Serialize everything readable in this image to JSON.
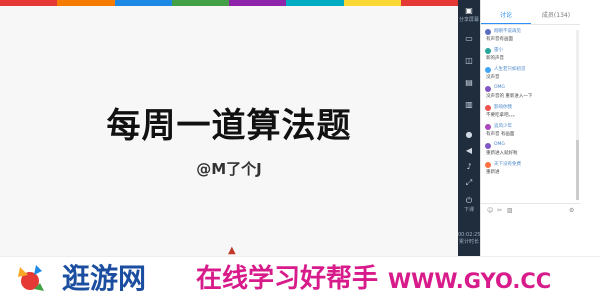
{
  "slide": {
    "title": "每周一道算法题",
    "subtitle": "@M了个J"
  },
  "stripe_colors": [
    "#e53935",
    "#f57c00",
    "#1e88e5",
    "#43a047",
    "#8e24aa",
    "#00acc1",
    "#fdd835",
    "#e53935"
  ],
  "toolbar": {
    "items": [
      {
        "icon": "screen-share-icon",
        "label": "分享屏幕"
      },
      {
        "icon": "video-icon",
        "label": ""
      },
      {
        "icon": "camera-icon",
        "label": ""
      },
      {
        "icon": "whiteboard-icon",
        "label": ""
      },
      {
        "icon": "doc-icon",
        "label": ""
      },
      {
        "icon": "mic-icon",
        "label": ""
      },
      {
        "icon": "speaker-icon",
        "label": ""
      },
      {
        "icon": "music-icon",
        "label": ""
      },
      {
        "icon": "fullscreen-icon",
        "label": ""
      },
      {
        "icon": "power-icon",
        "label": "下课"
      }
    ],
    "timer": "00:02:25",
    "timer_label": "累计时长"
  },
  "panel": {
    "tab_chat": "讨论",
    "tab_members": "成员(134)",
    "messages": [
      {
        "name": "刚刚不说再见",
        "text": "有声音有画面",
        "color": "#5c6bc0"
      },
      {
        "name": "雷小",
        "text": "新的声音",
        "color": "#26a69a"
      },
      {
        "name": "人生若只如初见",
        "text": "没声音",
        "color": "#42a5f5"
      },
      {
        "name": "OMG",
        "text": "没声音的 重新进入一下",
        "color": "#7e57c2"
      },
      {
        "name": "影响你我",
        "text": "不要吃拿吧。。。",
        "color": "#ef5350"
      },
      {
        "name": "追风少年",
        "text": "有声音 有画面",
        "color": "#ab47bc"
      },
      {
        "name": "OMG",
        "text": "重新进入就好啦",
        "color": "#7e57c2"
      },
      {
        "name": "天下没有免费",
        "text": "重新进",
        "color": "#ff7043"
      }
    ]
  },
  "banner": {
    "brand": "逛游网",
    "slogan": "在线学习好帮手",
    "url": "WWW.GYO.CC"
  }
}
